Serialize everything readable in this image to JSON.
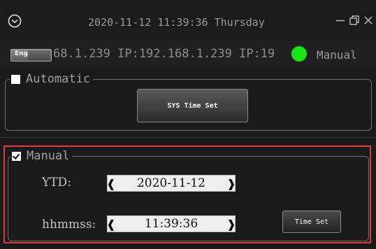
{
  "titlebar": {
    "datetime": "2020-11-12 11:39:36 Thursday"
  },
  "infobar": {
    "language_button": "Eng.",
    "ip_text": "68.1.239  IP:192.168.1.239  IP:19",
    "mode": "Manual",
    "status_color": "#17e616"
  },
  "automatic": {
    "label": "Automatic",
    "checked": false,
    "sys_time_set_label": "SYS Time Set"
  },
  "manual": {
    "label": "Manual",
    "checked": true,
    "date_label": "YTD:",
    "date_value": "2020-11-12",
    "time_label": "hhmmss:",
    "time_value": "11:39:36",
    "time_set_label": "Time Set"
  },
  "icons": {
    "app": "clock-circle-icon",
    "minimize": "minimize-icon",
    "restore": "restore-icon",
    "close": "close-icon"
  },
  "colors": {
    "highlight_frame": "#e03a3a",
    "background": "#1a1a1a"
  }
}
